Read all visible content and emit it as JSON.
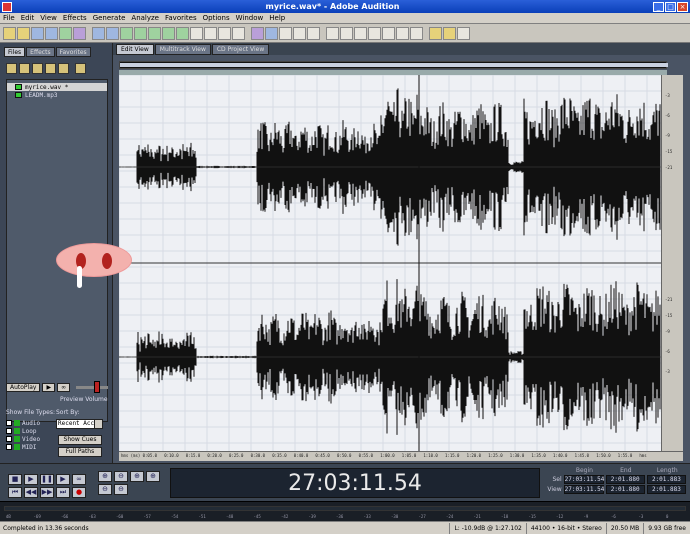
{
  "window": {
    "title": "myrice.wav* - Adobe Audition",
    "controls": [
      "_",
      "□",
      "×"
    ]
  },
  "menu": [
    "File",
    "Edit",
    "View",
    "Effects",
    "Generate",
    "Analyze",
    "Favorites",
    "Options",
    "Window",
    "Help"
  ],
  "left_panel": {
    "tabs": [
      "Files",
      "Effects",
      "Favorites"
    ],
    "files": [
      {
        "name": "myrice.wav *",
        "selected": true
      },
      {
        "name": "LEADM.mp3",
        "selected": false
      }
    ],
    "autoplay_label": "AutoPlay",
    "play_button": "▶",
    "loop_button": "∞",
    "preview_volume_label": "Preview Volume",
    "preview_volume_level": 0.5,
    "show_file_types_label": "Show File Types:",
    "sort_by_label": "Sort By:",
    "file_types": [
      "Audio",
      "Loop",
      "Video",
      "MIDI"
    ],
    "sort_selected": "Recent Acc",
    "show_cues_button": "Show Cues",
    "full_paths_button": "Full Paths"
  },
  "editor": {
    "tabs": [
      "Edit View",
      "Multitrack View",
      "CD Project View"
    ],
    "amplitude_labels": [
      "-3",
      "-6",
      "-9",
      "-15",
      "-21",
      "-21",
      "-15",
      "-9",
      "-6",
      "-3"
    ],
    "time_labels": [
      "hms (ms)",
      "0:05.0",
      "0:10.0",
      "0:15.0",
      "0:20.0",
      "0:25.0",
      "0:30.0",
      "0:35.0",
      "0:40.0",
      "0:45.0",
      "0:50.0",
      "0:55.0",
      "1:00.0",
      "1:05.0",
      "1:10.0",
      "1:15.0",
      "1:20.0",
      "1:25.0",
      "1:30.0",
      "1:35.0",
      "1:40.0",
      "1:45.0",
      "1:50.0",
      "1:55.0",
      "hms"
    ]
  },
  "transport": {
    "buttons_row1": [
      "■",
      "▶",
      "❚❚",
      "▶",
      "∞"
    ],
    "buttons_row2": [
      "⏮",
      "◀◀",
      "▶▶",
      "⏭",
      "●"
    ],
    "time": "27:03:11.54",
    "zoom_buttons": [
      "⊕",
      "⊖",
      "⊕",
      "⊕",
      "⊖",
      "⊖"
    ]
  },
  "selection": {
    "headers": [
      "Begin",
      "End",
      "Length"
    ],
    "rows": [
      {
        "label": "Sel",
        "begin": "27:03:11.54",
        "end": "2:01.880",
        "length": "2:01.883"
      },
      {
        "label": "View",
        "begin": "27:03:11.54",
        "end": "2:01.880",
        "length": "2:01.883"
      }
    ]
  },
  "meter_labels": [
    "dB",
    "-69",
    "-66",
    "-63",
    "-60",
    "-57",
    "-54",
    "-51",
    "-48",
    "-45",
    "-42",
    "-39",
    "-36",
    "-33",
    "-30",
    "-27",
    "-24",
    "-21",
    "-18",
    "-15",
    "-12",
    "-9",
    "-6",
    "-3",
    "0"
  ],
  "status": {
    "left": "Completed in 13.36 seconds",
    "level": "L: -10.9dB @ 1:27.102",
    "format": "44100 • 16-bit • Stereo",
    "size": "20.50 MB",
    "free": "9.93 GB free"
  }
}
